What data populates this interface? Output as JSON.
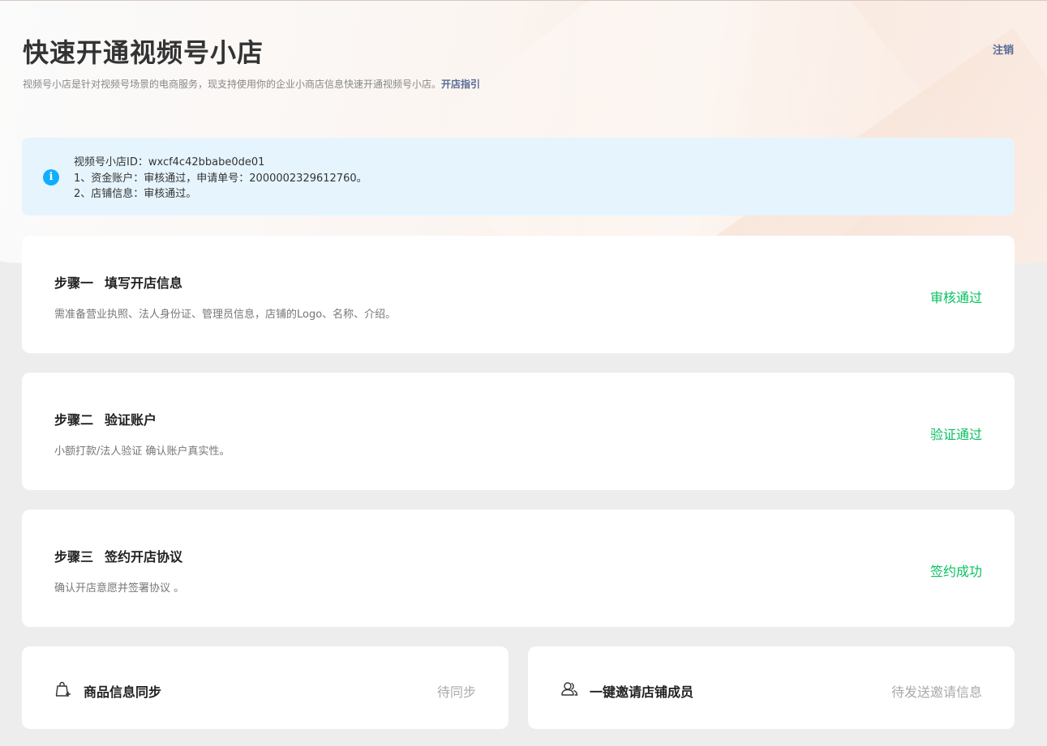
{
  "header": {
    "title": "快速开通视频号小店",
    "logout_label": "注销",
    "subtitle": "视频号小店是针对视频号场景的电商服务，现支持使用你的企业小商店信息快速开通视频号小店。",
    "guide_link": "开店指引"
  },
  "notice": {
    "icon": "info-icon",
    "lines": [
      "视频号小店ID：wxcf4c42bbabe0de01",
      "1、资金账户：审核通过，申请单号：2000002329612760。",
      "2、店铺信息：审核通过。"
    ]
  },
  "steps": [
    {
      "number": "步骤一",
      "title": "填写开店信息",
      "description": "需准备营业执照、法人身份证、管理员信息，店铺的Logo、名称、介绍。",
      "status": "审核通过"
    },
    {
      "number": "步骤二",
      "title": "验证账户",
      "description": "小额打款/法人验证 确认账户真实性。",
      "status": "验证通过"
    },
    {
      "number": "步骤三",
      "title": "签约开店协议",
      "description": "确认开店意愿并签署协议 。",
      "status": "签约成功"
    }
  ],
  "extras": [
    {
      "icon": "shopping-bag-icon",
      "label": "商品信息同步",
      "status": "待同步"
    },
    {
      "icon": "members-icon",
      "label": "一键邀请店铺成员",
      "status": "待发送邀请信息"
    }
  ],
  "colors": {
    "success": "#07c160",
    "link": "#576b95",
    "info": "#10aeff",
    "notice_bg": "#e6f4fd",
    "pending": "#aaaaaa"
  }
}
